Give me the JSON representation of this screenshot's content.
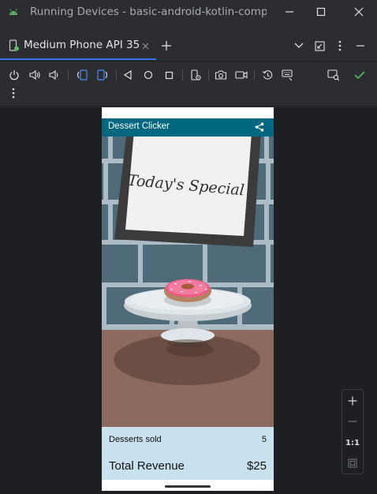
{
  "window": {
    "title": "Running Devices - basic-android-kotlin-compose-training-dessert-clicker"
  },
  "tab": {
    "label": "Medium Phone API 35"
  },
  "app": {
    "title": "Dessert Clicker",
    "sign_text": "Today's Special",
    "desserts_sold_label": "Desserts sold",
    "desserts_sold_value": "5",
    "total_revenue_label": "Total Revenue",
    "total_revenue_value": "$25"
  },
  "zoom": {
    "ratio_label": "1:1"
  },
  "colors": {
    "accent": "#3574f0",
    "app_bar": "#006781",
    "bottom_panel": "#c8e1ee",
    "check": "#5fb865"
  }
}
